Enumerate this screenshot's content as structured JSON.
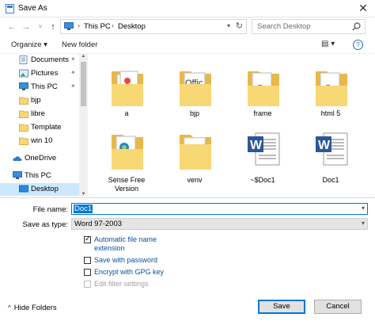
{
  "window": {
    "title": "Save As"
  },
  "address": {
    "crumbs": [
      "This PC",
      "Desktop"
    ]
  },
  "search": {
    "placeholder": "Search Desktop"
  },
  "toolbar": {
    "organize_label": "Organize ▾",
    "new_folder_label": "New folder"
  },
  "sidebar": {
    "items": [
      {
        "label": "Documents",
        "icon": "documents-icon",
        "pinned": true
      },
      {
        "label": "Pictures",
        "icon": "pictures-icon",
        "pinned": true
      },
      {
        "label": "This PC",
        "icon": "pc-icon",
        "pinned": true
      },
      {
        "label": "bjp",
        "icon": "folder-icon"
      },
      {
        "label": "libre",
        "icon": "folder-icon"
      },
      {
        "label": "Template",
        "icon": "folder-icon"
      },
      {
        "label": "win 10",
        "icon": "folder-icon"
      },
      {
        "label": "OneDrive",
        "icon": "onedrive-icon"
      },
      {
        "label": "This PC",
        "icon": "pc-icon"
      },
      {
        "label": "Desktop",
        "icon": "desktop-icon",
        "selected": true
      }
    ]
  },
  "files": [
    {
      "name": "a",
      "icon": "folder-with-documents-icon"
    },
    {
      "name": "bjp",
      "icon": "folder-with-office-icon"
    },
    {
      "name": "frame",
      "icon": "folder-with-edge-icon"
    },
    {
      "name": "html 5",
      "icon": "folder-with-edge-icon"
    },
    {
      "name": "Sense Free Version",
      "icon": "folder-with-documents-icon"
    },
    {
      "name": "venv",
      "icon": "folder-icon"
    },
    {
      "name": "~$Doc1",
      "icon": "word-document-icon"
    },
    {
      "name": "Doc1",
      "icon": "word-document-icon"
    }
  ],
  "form": {
    "file_name_label": "File name:",
    "file_name_value": "Doc1",
    "save_type_label": "Save as type:",
    "save_type_value": "Word 97-2003"
  },
  "options": {
    "auto_ext": {
      "label": "Automatic file name extension",
      "checked": true
    },
    "save_password": {
      "label": "Save with password",
      "checked": false
    },
    "encrypt_gpg": {
      "label": "Encrypt with GPG key",
      "checked": false
    },
    "edit_filter": {
      "label": "Edit filter settings",
      "checked": false,
      "disabled": true
    }
  },
  "footer": {
    "hide_folders_label": "Hide Folders",
    "save_label": "Save",
    "cancel_label": "Cancel"
  },
  "colors": {
    "accent": "#0078d7",
    "selected_bg": "#cce8ff",
    "folder": "#f8d775"
  }
}
